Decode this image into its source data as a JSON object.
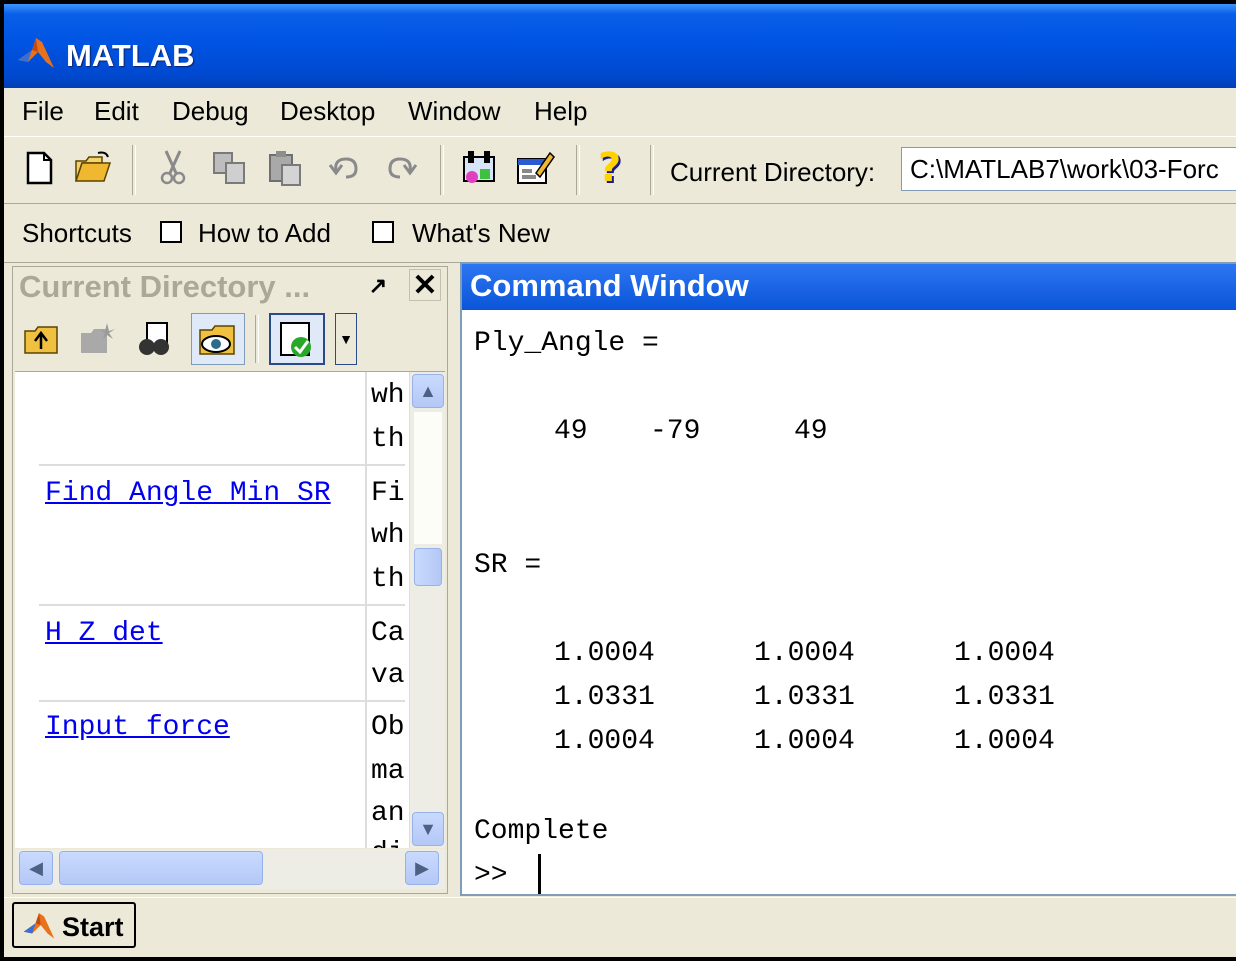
{
  "window": {
    "title": "MATLAB"
  },
  "menu": [
    "File",
    "Edit",
    "Debug",
    "Desktop",
    "Window",
    "Help"
  ],
  "toolbar": {
    "icons": [
      "new-file-icon",
      "open-folder-icon",
      "cut-icon",
      "copy-icon",
      "paste-icon",
      "undo-icon",
      "redo-icon",
      "simulink-icon",
      "guide-icon",
      "help-icon"
    ],
    "current_directory_label": "Current Directory:",
    "current_directory_value": "C:\\MATLAB7\\work\\03-Forc"
  },
  "shortcuts": {
    "label": "Shortcuts",
    "items": [
      "How to Add",
      "What's New"
    ]
  },
  "current_directory_panel": {
    "title": "Current Directory ...",
    "rows": [
      {
        "link": "",
        "desc": [
          "wh",
          "th"
        ]
      },
      {
        "link": "Find Angle Min SR",
        "desc": [
          "Fi",
          "wh",
          "th"
        ]
      },
      {
        "link": "H Z det",
        "desc": [
          "Ca",
          "va"
        ]
      },
      {
        "link": "Input force",
        "desc": [
          "Ob",
          "ma",
          "an",
          "di"
        ]
      }
    ]
  },
  "command_window": {
    "title": "Command Window",
    "ply_angle_label": "Ply_Angle =",
    "ply_angle_values": [
      "49",
      "-79",
      "49"
    ],
    "sr_label": "SR =",
    "sr_rows": [
      [
        "1.0004",
        "1.0004",
        "1.0004"
      ],
      [
        "1.0331",
        "1.0331",
        "1.0331"
      ],
      [
        "1.0004",
        "1.0004",
        "1.0004"
      ]
    ],
    "status": "Complete",
    "prompt": ">>"
  },
  "start": {
    "label": "Start"
  },
  "colors": {
    "title_blue": "#0054e3",
    "link_blue": "#0000ee",
    "panel_bg": "#ece9d8"
  }
}
